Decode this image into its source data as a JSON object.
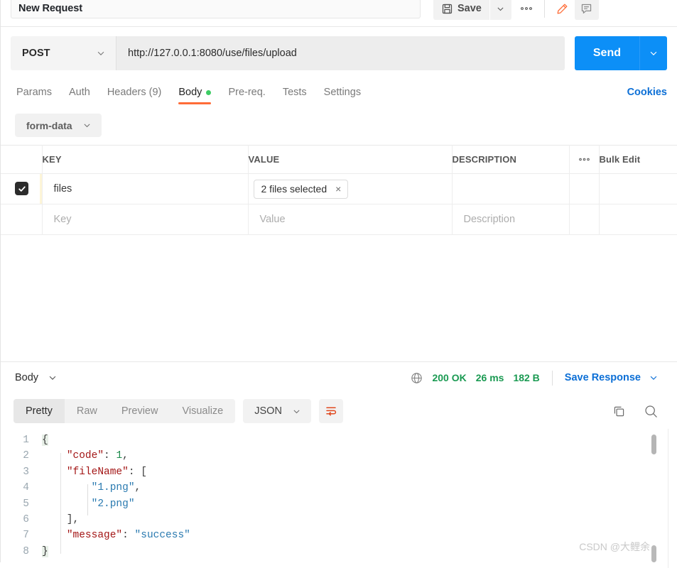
{
  "request": {
    "title": "New Request",
    "method": "POST",
    "url": "http://127.0.0.1:8080/use/files/upload",
    "send_label": "Send"
  },
  "toolbar": {
    "save_label": "Save",
    "save_icon": "floppy-disk-icon",
    "caret_icon": "chevron-down-icon",
    "kebab_icon": "ellipsis-horizontal-icon",
    "pencil_icon": "pencil-icon",
    "comment_icon": "comment-icon",
    "accent_color": "#ff6c37"
  },
  "tabs": {
    "items": [
      {
        "label": "Params",
        "active": false,
        "dot": false
      },
      {
        "label": "Auth",
        "active": false,
        "dot": false
      },
      {
        "label": "Headers (9)",
        "active": false,
        "dot": false
      },
      {
        "label": "Body",
        "active": true,
        "dot": true
      },
      {
        "label": "Pre-req.",
        "active": false,
        "dot": false
      },
      {
        "label": "Tests",
        "active": false,
        "dot": false
      },
      {
        "label": "Settings",
        "active": false,
        "dot": false
      }
    ],
    "cookies_label": "Cookies",
    "active_underline_color": "#ff6c37",
    "dot_color": "#3dcc64"
  },
  "body_editor": {
    "mode_label": "form-data",
    "columns": {
      "key": "KEY",
      "value": "VALUE",
      "description": "DESCRIPTION",
      "dots": "•••",
      "bulk_edit": "Bulk Edit"
    },
    "rows": [
      {
        "checked": true,
        "key": "files",
        "value_chip": "2 files selected",
        "chip_close": "×",
        "description": ""
      }
    ],
    "placeholder_row": {
      "key": "Key",
      "value": "Value",
      "description": "Description"
    }
  },
  "response": {
    "body_label": "Body",
    "globe_icon": "globe-icon",
    "status": "200 OK",
    "time": "26 ms",
    "size": "182 B",
    "status_color": "#1a9a52",
    "save_response_label": "Save Response",
    "view_tabs": [
      "Pretty",
      "Raw",
      "Preview",
      "Visualize"
    ],
    "active_view_tab": "Pretty",
    "format_label": "JSON",
    "wrap_icon": "word-wrap-icon",
    "copy_icon": "copy-icon",
    "search_icon": "search-icon"
  },
  "code": {
    "lines": [
      {
        "n": "1",
        "tokens": [
          {
            "t": "{",
            "c": "brace"
          }
        ]
      },
      {
        "n": "2",
        "tokens": [
          {
            "t": "    ",
            "c": "punc"
          },
          {
            "t": "\"code\"",
            "c": "key"
          },
          {
            "t": ": ",
            "c": "punc"
          },
          {
            "t": "1",
            "c": "num"
          },
          {
            "t": ",",
            "c": "punc"
          }
        ]
      },
      {
        "n": "3",
        "tokens": [
          {
            "t": "    ",
            "c": "punc"
          },
          {
            "t": "\"fileName\"",
            "c": "key"
          },
          {
            "t": ": [",
            "c": "punc"
          }
        ]
      },
      {
        "n": "4",
        "tokens": [
          {
            "t": "        ",
            "c": "punc"
          },
          {
            "t": "\"1.png\"",
            "c": "str"
          },
          {
            "t": ",",
            "c": "punc"
          }
        ]
      },
      {
        "n": "5",
        "tokens": [
          {
            "t": "        ",
            "c": "punc"
          },
          {
            "t": "\"2.png\"",
            "c": "str"
          }
        ]
      },
      {
        "n": "6",
        "tokens": [
          {
            "t": "    ],",
            "c": "punc"
          }
        ]
      },
      {
        "n": "7",
        "tokens": [
          {
            "t": "    ",
            "c": "punc"
          },
          {
            "t": "\"message\"",
            "c": "key"
          },
          {
            "t": ": ",
            "c": "punc"
          },
          {
            "t": "\"success\"",
            "c": "str"
          }
        ]
      },
      {
        "n": "8",
        "tokens": [
          {
            "t": "}",
            "c": "brace"
          }
        ]
      }
    ],
    "raw": "{\n    \"code\": 1,\n    \"fileName\": [\n        \"1.png\",\n        \"2.png\"\n    ],\n    \"message\": \"success\"\n}"
  },
  "watermark": "CSDN @大鲤余"
}
